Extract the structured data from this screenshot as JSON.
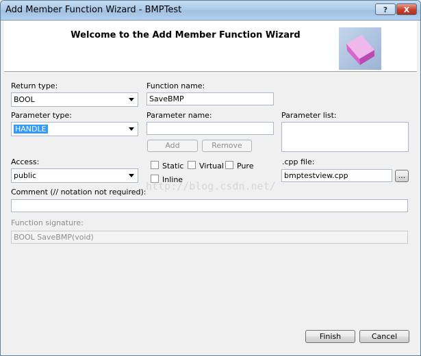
{
  "window": {
    "title": "Add Member Function Wizard - BMPTest",
    "help_label": "?",
    "close_label": "X"
  },
  "banner": {
    "welcome": "Welcome to the Add Member Function Wizard",
    "image_icon": "pink-cube-icon"
  },
  "form": {
    "return_type_label": "Return type:",
    "return_type_value": "BOOL",
    "function_name_label": "Function name:",
    "function_name_value": "SaveBMP",
    "parameter_type_label": "Parameter type:",
    "parameter_type_value": "HANDLE",
    "parameter_name_label": "Parameter name:",
    "parameter_name_value": "",
    "parameter_list_label": "Parameter list:",
    "add_label": "Add",
    "remove_label": "Remove",
    "access_label": "Access:",
    "access_value": "public",
    "static_label": "Static",
    "virtual_label": "Virtual",
    "pure_label": "Pure",
    "inline_label": "Inline",
    "cpp_file_label": ".cpp file:",
    "cpp_file_value": "bmptestview.cpp",
    "browse_label": "...",
    "comment_label": "Comment (// notation not required):",
    "comment_value": "",
    "signature_label": "Function signature:",
    "signature_value": "BOOL SaveBMP(void)"
  },
  "watermark": "http://blog.csdn.net/",
  "footer": {
    "finish_label": "Finish",
    "cancel_label": "Cancel"
  },
  "colors": {
    "selection": "#3399ff",
    "cube": "#e07ad8",
    "close_button": "#c7402b"
  }
}
